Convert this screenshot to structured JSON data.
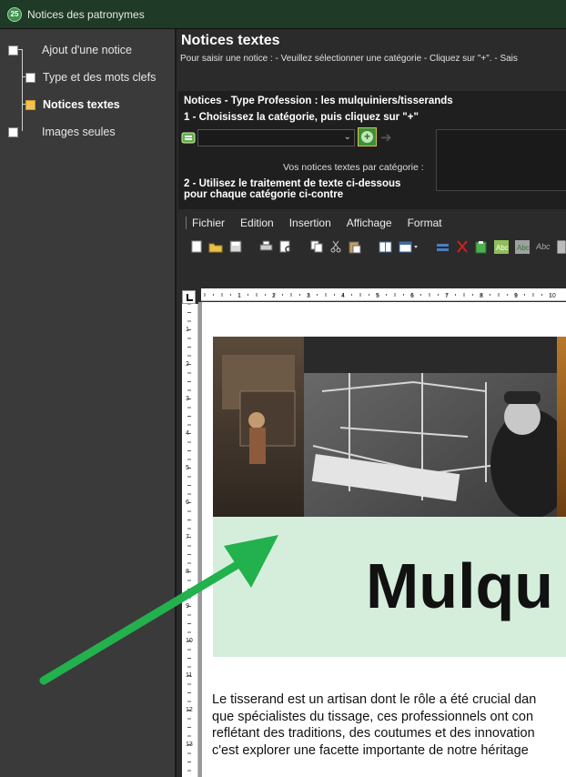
{
  "window": {
    "title": "Notices des patronymes",
    "logo_text": "25"
  },
  "sidebar": {
    "items": [
      {
        "label": "Ajout d'une notice",
        "active": false
      },
      {
        "label": "Type et des mots clefs",
        "active": false
      },
      {
        "label": "Notices textes",
        "active": true
      },
      {
        "label": "Images seules",
        "active": false
      }
    ]
  },
  "header": {
    "title": "Notices textes",
    "subtitle": "Pour saisir une notice : - Veuillez sélectionner une catégorie - Cliquez sur \"+\". - Sais"
  },
  "panel": {
    "line1": "Notices - Type Profession : les mulquiniers/tisserands",
    "line2": "1 - Choisissez la catégorie, puis cliquez sur \"+\"",
    "category_select_value": "",
    "category_list_label": "Vos notices textes par catégorie :",
    "line3a": "2 - Utilisez le traitement de texte ci-dessous",
    "line3b": "pour chaque catégorie ci-contre"
  },
  "menu": {
    "items": [
      "Fichier",
      "Edition",
      "Insertion",
      "Affichage",
      "Format"
    ]
  },
  "toolbar": {
    "icons": [
      "new-document-icon",
      "open-folder-icon",
      "save-icon",
      "print-icon",
      "print-preview-icon",
      "copy-icon",
      "cut-icon",
      "paste-icon",
      "columns-icon",
      "table-icon",
      "strikeline-icon",
      "scissors-red-icon",
      "clipboard-green-icon",
      "spellcheck-icon",
      "spellcheck-auto-icon",
      "abc-icon",
      "extra-icon"
    ]
  },
  "ruler": {
    "h_marks": [
      "1",
      "2",
      "3",
      "4",
      "5",
      "6",
      "7",
      "8",
      "9",
      "10"
    ],
    "v_marks": [
      "1",
      "2",
      "3",
      "4",
      "5",
      "6",
      "7",
      "8",
      "9",
      "10",
      "11",
      "12",
      "13"
    ]
  },
  "document": {
    "big_title": "Mulqu",
    "paragraph": [
      "Le tisserand est un artisan dont le rôle a été crucial dan",
      "que spécialistes du tissage, ces professionnels ont con",
      "reflétant des traditions, des coutumes et des innovation",
      "c'est explorer une facette importante de notre héritage"
    ]
  },
  "colors": {
    "accent_green": "#22b14c",
    "title_band": "#d5eedc",
    "active_tree": "#f2c14e"
  }
}
